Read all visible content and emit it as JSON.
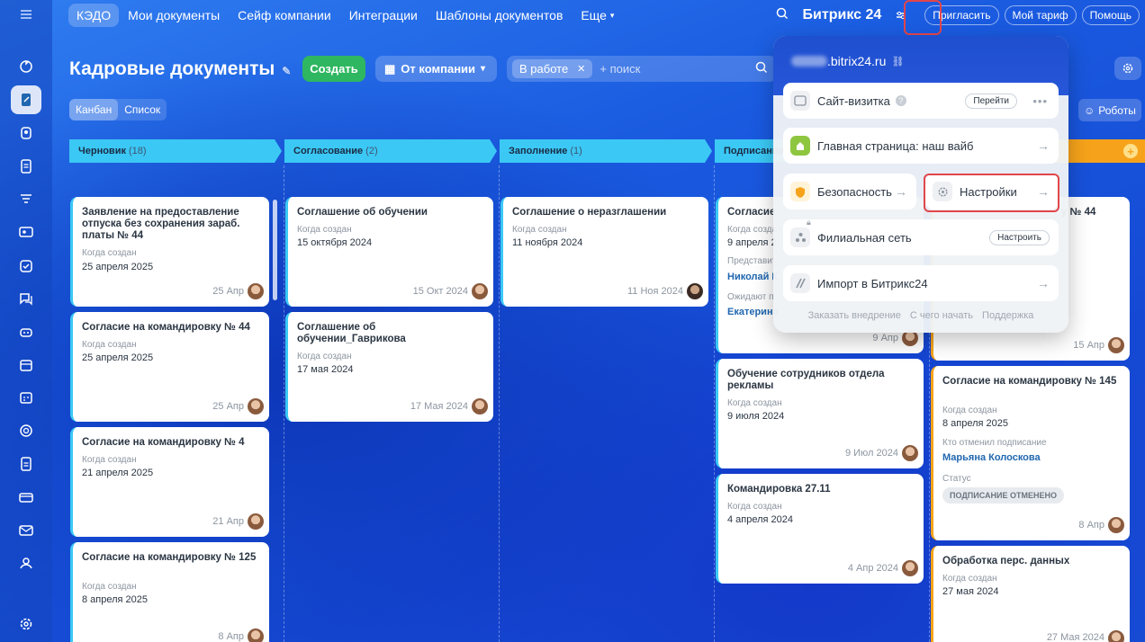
{
  "topnav": {
    "items": [
      "КЭДО",
      "Мои документы",
      "Сейф компании",
      "Интеграции",
      "Шаблоны документов",
      "Еще"
    ],
    "brand": "Битрикс 24",
    "invite": "Пригласить",
    "tariff": "Мой тариф",
    "help": "Помощь"
  },
  "page": {
    "title": "Кадровые документы",
    "create": "Создать",
    "company_filter": "От компании",
    "search_tag": "В работе",
    "search_placeholder": "+ поиск",
    "view_tabs": [
      "Канбан",
      "Список"
    ],
    "robots": "Роботы"
  },
  "columns": [
    {
      "name": "Черновик",
      "count": "(18)",
      "color": "#3bc8f5"
    },
    {
      "name": "Согласование",
      "count": "(2)",
      "color": "#3bc8f5"
    },
    {
      "name": "Заполнение",
      "count": "(1)",
      "color": "#3bc8f5"
    },
    {
      "name": "Подписание",
      "count": "",
      "color": "#3bc8f5"
    },
    {
      "name": "",
      "count": "",
      "color": "#f6a31b"
    }
  ],
  "cards": {
    "c1": [
      {
        "title": "Заявление на предоставление отпуска без сохранения зараб. платы № 44",
        "label": "Когда создан",
        "value": "25 апреля 2025",
        "date": "25 Апр"
      },
      {
        "title": "Согласие на командировку № 44",
        "label": "Когда создан",
        "value": "25 апреля 2025",
        "date": "25 Апр"
      },
      {
        "title": "Согласие на командировку № 4",
        "label": "Когда создан",
        "value": "21 апреля 2025",
        "date": "21 Апр"
      },
      {
        "title": "Согласие на командировку № 125",
        "label": "Когда создан",
        "value": "8 апреля 2025",
        "date": "8 Апр"
      }
    ],
    "c2": [
      {
        "title": "Соглашение об обучении",
        "label": "Когда создан",
        "value": "15 октября 2024",
        "date": "15 Окт 2024"
      },
      {
        "title": "Соглашение об обучении_Гаврикова",
        "label": "Когда создан",
        "value": "17 мая 2024",
        "date": "17 Мая 2024"
      }
    ],
    "c3": [
      {
        "title": "Соглашение о неразглашении",
        "label": "Когда создан",
        "value": "11 ноября 2024",
        "date": "11 Ноя 2024"
      }
    ],
    "c4": [
      {
        "title": "Согласие",
        "label": "Когда создан",
        "value": "9 апреля 2",
        "label2": "Представит",
        "link": "Николай К",
        "label3": "Ожидают п",
        "link2": "Екатерина",
        "date": "9 Апр"
      },
      {
        "title": "Обучение сотрудников отдела рекламы",
        "label": "Когда создан",
        "value": "9 июля 2024",
        "date": "9 Июл 2024"
      },
      {
        "title": "Командировка 27.11",
        "label": "Когда создан",
        "value": "4 апреля 2024",
        "date": "4 Апр 2024"
      }
    ],
    "c5": [
      {
        "title": "у № 44",
        "date": "15 Апр"
      },
      {
        "title": "Согласие на командировку № 145",
        "label": "Когда создан",
        "value": "8 апреля 2025",
        "label2": "Кто отменил подписание",
        "link": "Марьяна Колоскова",
        "label3": "Статус",
        "status": "ПОДПИСАНИЕ ОТМЕНЕНО",
        "date": "8 Апр"
      },
      {
        "title": "Обработка перс. данных",
        "label": "Когда создан",
        "value": "27 мая 2024",
        "date": "27 Мая 2024"
      }
    ]
  },
  "popup": {
    "domain": ".bitrix24.ru",
    "site_card": "Сайт-визитка",
    "site_go": "Перейти",
    "homepage": "Главная страница: наш вайб",
    "security": "Безопасность",
    "settings": "Настройки",
    "branch": "Филиальная сеть",
    "branch_btn": "Настроить",
    "import": "Импорт в Битрикс24",
    "footer": [
      "Заказать внедрение",
      "С чего начать",
      "Поддержка"
    ]
  },
  "colors": {
    "accent_green": "#2eb760",
    "highlight": "#e2464b",
    "column_blue": "#3bc8f5",
    "column_orange": "#f6a31b"
  }
}
